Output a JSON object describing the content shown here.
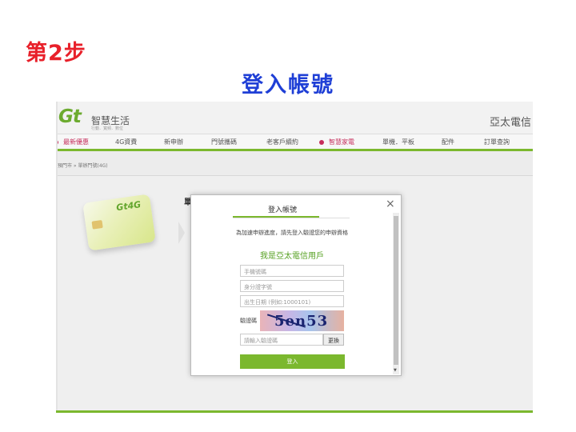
{
  "slide": {
    "step": "第2步",
    "title": "登入帳號"
  },
  "site": {
    "logo_text": "Gt",
    "logo_name": "智慧生活",
    "logo_sub": "行動．寬頻．數位",
    "brand": "亞太電信",
    "nav": [
      {
        "label": "最新優惠",
        "highlight": true
      },
      {
        "label": "4G資費",
        "highlight": false
      },
      {
        "label": "新申辦",
        "highlight": false
      },
      {
        "label": "門號攜碼",
        "highlight": false
      },
      {
        "label": "老客戶續約",
        "highlight": false
      },
      {
        "label": "智慧家電",
        "highlight": true
      },
      {
        "label": "單機．平板",
        "highlight": false
      },
      {
        "label": "配件",
        "highlight": false
      },
      {
        "label": "訂單查詢",
        "highlight": false
      }
    ],
    "breadcrumb": "預門市 » 單辦門號(4G)",
    "product_logo": "Gt4G",
    "bg_title_fragment": "單"
  },
  "modal": {
    "close": "×",
    "tab_label": "登入帳號",
    "description": "為加速申辦進度，請先登入驗證您的申辦資格",
    "heading": "我是亞太電信用戶",
    "fields": {
      "phone_placeholder": "手機號碼",
      "id_placeholder": "身分證字號",
      "birth_placeholder": "出生日期 (例如:1000101)"
    },
    "captcha_label": "驗證碼",
    "captcha_text": "5en53",
    "captcha_input_placeholder": "請輸入驗證碼",
    "refresh_label": "更換",
    "login_label": "登入"
  },
  "colors": {
    "step_red": "#e8202a",
    "title_blue": "#1f3fd6",
    "brand_green": "#7bb82e",
    "nav_highlight": "#c62d5b"
  }
}
